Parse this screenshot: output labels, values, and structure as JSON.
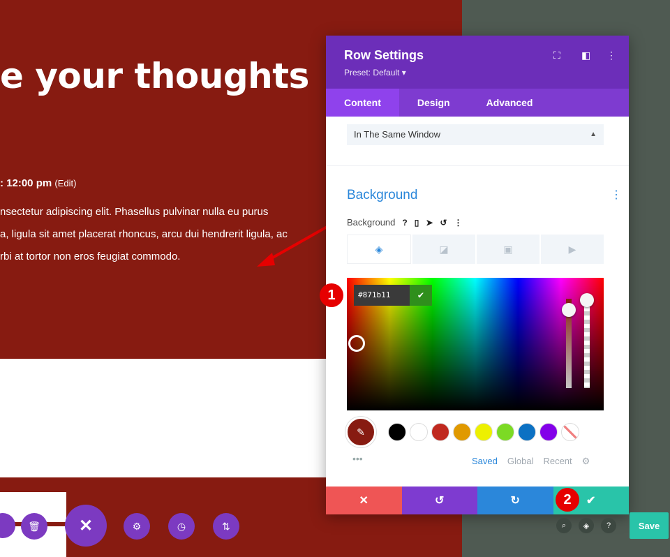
{
  "page": {
    "headline": "e your thoughts",
    "meta_time": ": 12:00 pm",
    "meta_edit": "(Edit)",
    "body_lines": [
      "nsectetur adipiscing elit. Phasellus pulvinar nulla eu purus",
      "a, ligula sit amet placerat rhoncus, arcu dui hendrerit ligula, ac",
      "rbi at tortor non eros feugiat commodo."
    ]
  },
  "panel": {
    "title": "Row Settings",
    "preset": "Preset: Default ▾",
    "tabs": [
      "Content",
      "Design",
      "Advanced"
    ],
    "link_target": "In The Same Window",
    "section_title": "Background",
    "background_label": "Background",
    "color_hex": "#871b11",
    "swatch_tabs": [
      "Saved",
      "Global",
      "Recent"
    ],
    "swatches": [
      "#000000",
      "#ffffff",
      "#c0291f",
      "#e09900",
      "#edf000",
      "#7cda24",
      "#0c71c3",
      "#8300e9"
    ]
  },
  "annotations": {
    "badge1": "1",
    "badge2": "2"
  },
  "toolbar": {
    "save_label": "Save"
  },
  "colors": {
    "accent_purple": "#6c2eb9",
    "red_bg": "#871b11",
    "save_green": "#29c4a9"
  }
}
